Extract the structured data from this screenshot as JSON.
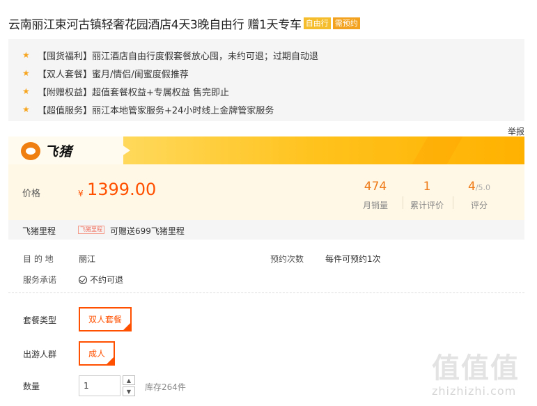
{
  "header": {
    "title": "云南丽江束河古镇轻奢花园酒店4天3晚自由行 赠1天专车",
    "tags": [
      "自由行",
      "需预约"
    ]
  },
  "features": [
    "【囤货福利】丽江酒店自由行度假套餐放心囤，未约可退；过期自动退",
    "【双人套餐】蜜月/情侣/闺蜜度假推荐",
    "【附赠权益】超值套餐权益+专属权益 售完即止",
    "【超值服务】丽江本地管家服务+24小时线上金牌管家服务"
  ],
  "report_label": "举报",
  "brand": {
    "name": "飞猪"
  },
  "price": {
    "label": "价格",
    "currency": "¥",
    "value": "1399.00"
  },
  "stats": [
    {
      "value": "474",
      "suffix": "",
      "label": "月销量"
    },
    {
      "value": "1",
      "suffix": "",
      "label": "累计评价"
    },
    {
      "value": "4",
      "suffix": "/5.0",
      "label": "评分"
    }
  ],
  "miles": {
    "label": "飞猪里程",
    "tag": "飞猪里程",
    "text": "可赠送699飞猪里程"
  },
  "info": {
    "destination_label": "目 的 地",
    "destination_value": "丽江",
    "bookings_label": "预约次数",
    "bookings_value": "每件可预约1次",
    "promise_label": "服务承诺",
    "promise_value": "不约可退"
  },
  "options": {
    "package_label": "套餐类型",
    "package_value": "双人套餐",
    "group_label": "出游人群",
    "group_value": "成人"
  },
  "quantity": {
    "label": "数量",
    "value": "1",
    "increment": "▲",
    "decrement": "▼",
    "stock": "库存264件"
  },
  "watermark": {
    "chars": "值值值",
    "url": "zhizhizhi.com"
  },
  "colors": {
    "accent": "#ff5000",
    "stat": "#ee7a18",
    "banner": "#ffc21c"
  }
}
